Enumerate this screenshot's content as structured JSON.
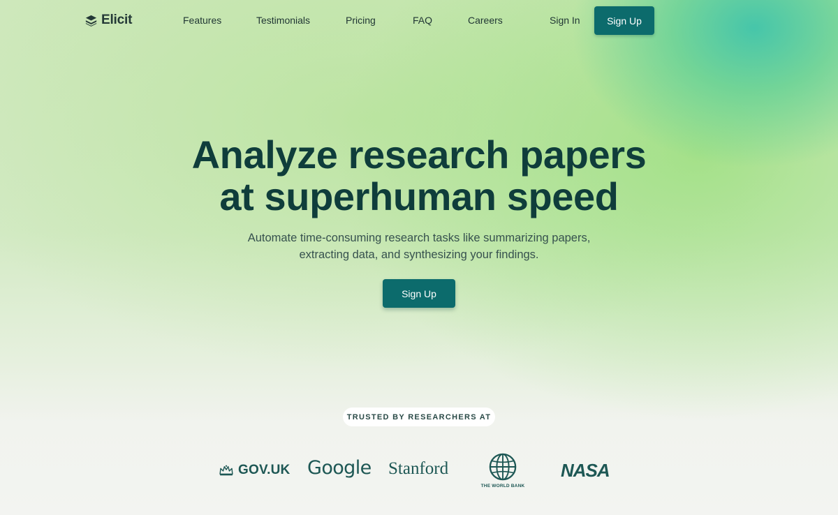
{
  "nav": {
    "logo_text": "Elicit",
    "links": [
      "Features",
      "Testimonials",
      "Pricing",
      "FAQ",
      "Careers"
    ],
    "sign_in": "Sign In",
    "sign_up": "Sign Up"
  },
  "hero": {
    "title_line1": "Analyze research papers",
    "title_line2": "at superhuman speed",
    "subtitle_line1": "Automate time-consuming research tasks like summarizing papers,",
    "subtitle_line2": "extracting data, and synthesizing your findings.",
    "cta": "Sign Up"
  },
  "trusted": {
    "label": "TRUSTED BY RESEARCHERS AT",
    "logos": [
      {
        "name": "GOV.UK",
        "icon": "crown-icon"
      },
      {
        "name": "Google"
      },
      {
        "name": "Stanford"
      },
      {
        "name": "THE WORLD BANK",
        "icon": "globe-icon"
      },
      {
        "name": "NASA"
      }
    ]
  },
  "colors": {
    "primary": "#0c6b6c",
    "heading": "#0f3d3b",
    "brand_logo": "#1d5754"
  }
}
